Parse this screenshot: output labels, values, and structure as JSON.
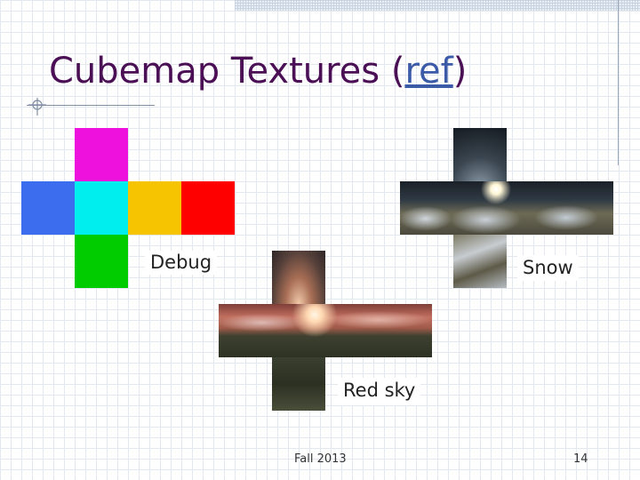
{
  "slide": {
    "title_prefix": "Cubemap Textures (",
    "title_link": "ref",
    "title_suffix": ")",
    "footer_left": "Fall 2013",
    "page_number": "14"
  },
  "cubemaps": [
    {
      "caption": "Debug",
      "face_colors": {
        "top": "#ee11dd",
        "left": "#3b6dee",
        "front": "#00eeee",
        "right": "#f6c400",
        "back": "#ff0000",
        "bottom": "#00cc00"
      }
    },
    {
      "caption": "Snow"
    },
    {
      "caption": "Red sky"
    }
  ]
}
